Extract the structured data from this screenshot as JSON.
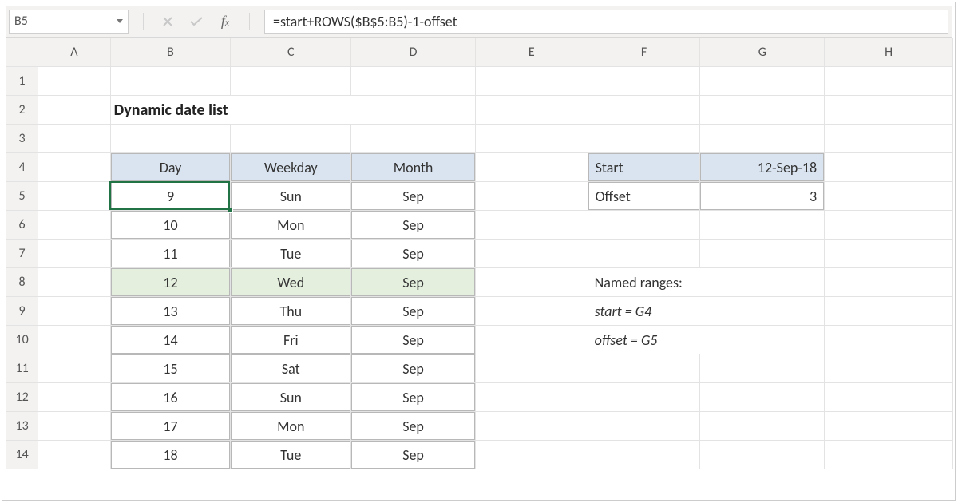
{
  "name_box": "B5",
  "formula": "=start+ROWS($B$5:B5)-1-offset",
  "columns": [
    "A",
    "B",
    "C",
    "D",
    "E",
    "F",
    "G",
    "H"
  ],
  "rows": [
    "1",
    "2",
    "3",
    "4",
    "5",
    "6",
    "7",
    "8",
    "9",
    "10",
    "11",
    "12",
    "13",
    "14"
  ],
  "selected_col": "B",
  "selected_row": "5",
  "title": "Dynamic date list",
  "table_headers": {
    "day": "Day",
    "weekday": "Weekday",
    "month": "Month"
  },
  "data_rows": [
    {
      "day": "9",
      "wk": "Sun",
      "mo": "Sep",
      "hl": false
    },
    {
      "day": "10",
      "wk": "Mon",
      "mo": "Sep",
      "hl": false
    },
    {
      "day": "11",
      "wk": "Tue",
      "mo": "Sep",
      "hl": false
    },
    {
      "day": "12",
      "wk": "Wed",
      "mo": "Sep",
      "hl": true
    },
    {
      "day": "13",
      "wk": "Thu",
      "mo": "Sep",
      "hl": false
    },
    {
      "day": "14",
      "wk": "Fri",
      "mo": "Sep",
      "hl": false
    },
    {
      "day": "15",
      "wk": "Sat",
      "mo": "Sep",
      "hl": false
    },
    {
      "day": "16",
      "wk": "Sun",
      "mo": "Sep",
      "hl": false
    },
    {
      "day": "17",
      "wk": "Mon",
      "mo": "Sep",
      "hl": false
    },
    {
      "day": "18",
      "wk": "Tue",
      "mo": "Sep",
      "hl": false
    }
  ],
  "side": {
    "start_label": "Start",
    "start_value": "12-Sep-18",
    "offset_label": "Offset",
    "offset_value": "3"
  },
  "notes": {
    "heading": "Named ranges:",
    "line1": "start = G4",
    "line2": "offset = G5"
  }
}
